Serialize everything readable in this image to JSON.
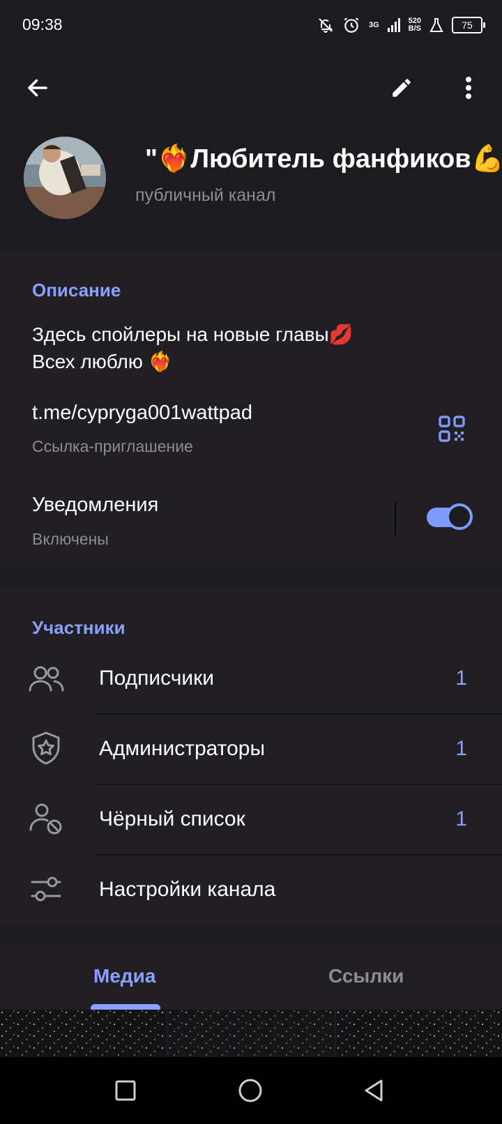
{
  "status_bar": {
    "time": "09:38",
    "network_type": "3G",
    "net_speed_value": "520",
    "net_speed_unit": "B/S",
    "battery": "75"
  },
  "toolbar": {
    "back_icon": "arrow-left-icon",
    "edit_icon": "pencil-icon",
    "more_icon": "more-vertical-icon"
  },
  "channel": {
    "name": "\"❤️‍🔥Любитель фанфиков💪",
    "subtitle": "публичный канал"
  },
  "info": {
    "description_title": "Описание",
    "description_line1": "Здесь спойлеры на новые главы💋",
    "description_line2": "Всех люблю ❤️‍🔥",
    "link": "t.me/cypryga001wattpad",
    "link_caption": "Ссылка-приглашение",
    "notifications_label": "Уведомления",
    "notifications_state": "Включены",
    "notifications_enabled": true
  },
  "members": {
    "title": "Участники",
    "items": [
      {
        "label": "Подписчики",
        "count": "1",
        "icon": "people-icon"
      },
      {
        "label": "Администраторы",
        "count": "1",
        "icon": "shield-star-icon"
      },
      {
        "label": "Чёрный список",
        "count": "1",
        "icon": "user-blocked-icon"
      },
      {
        "label": "Настройки канала",
        "count": "",
        "icon": "sliders-icon"
      }
    ]
  },
  "tabs": {
    "media": "Медиа",
    "links": "Ссылки",
    "active": "media"
  },
  "colors": {
    "accent": "#8aa0ff",
    "background": "#1c1b1f",
    "section": "#211f24"
  }
}
